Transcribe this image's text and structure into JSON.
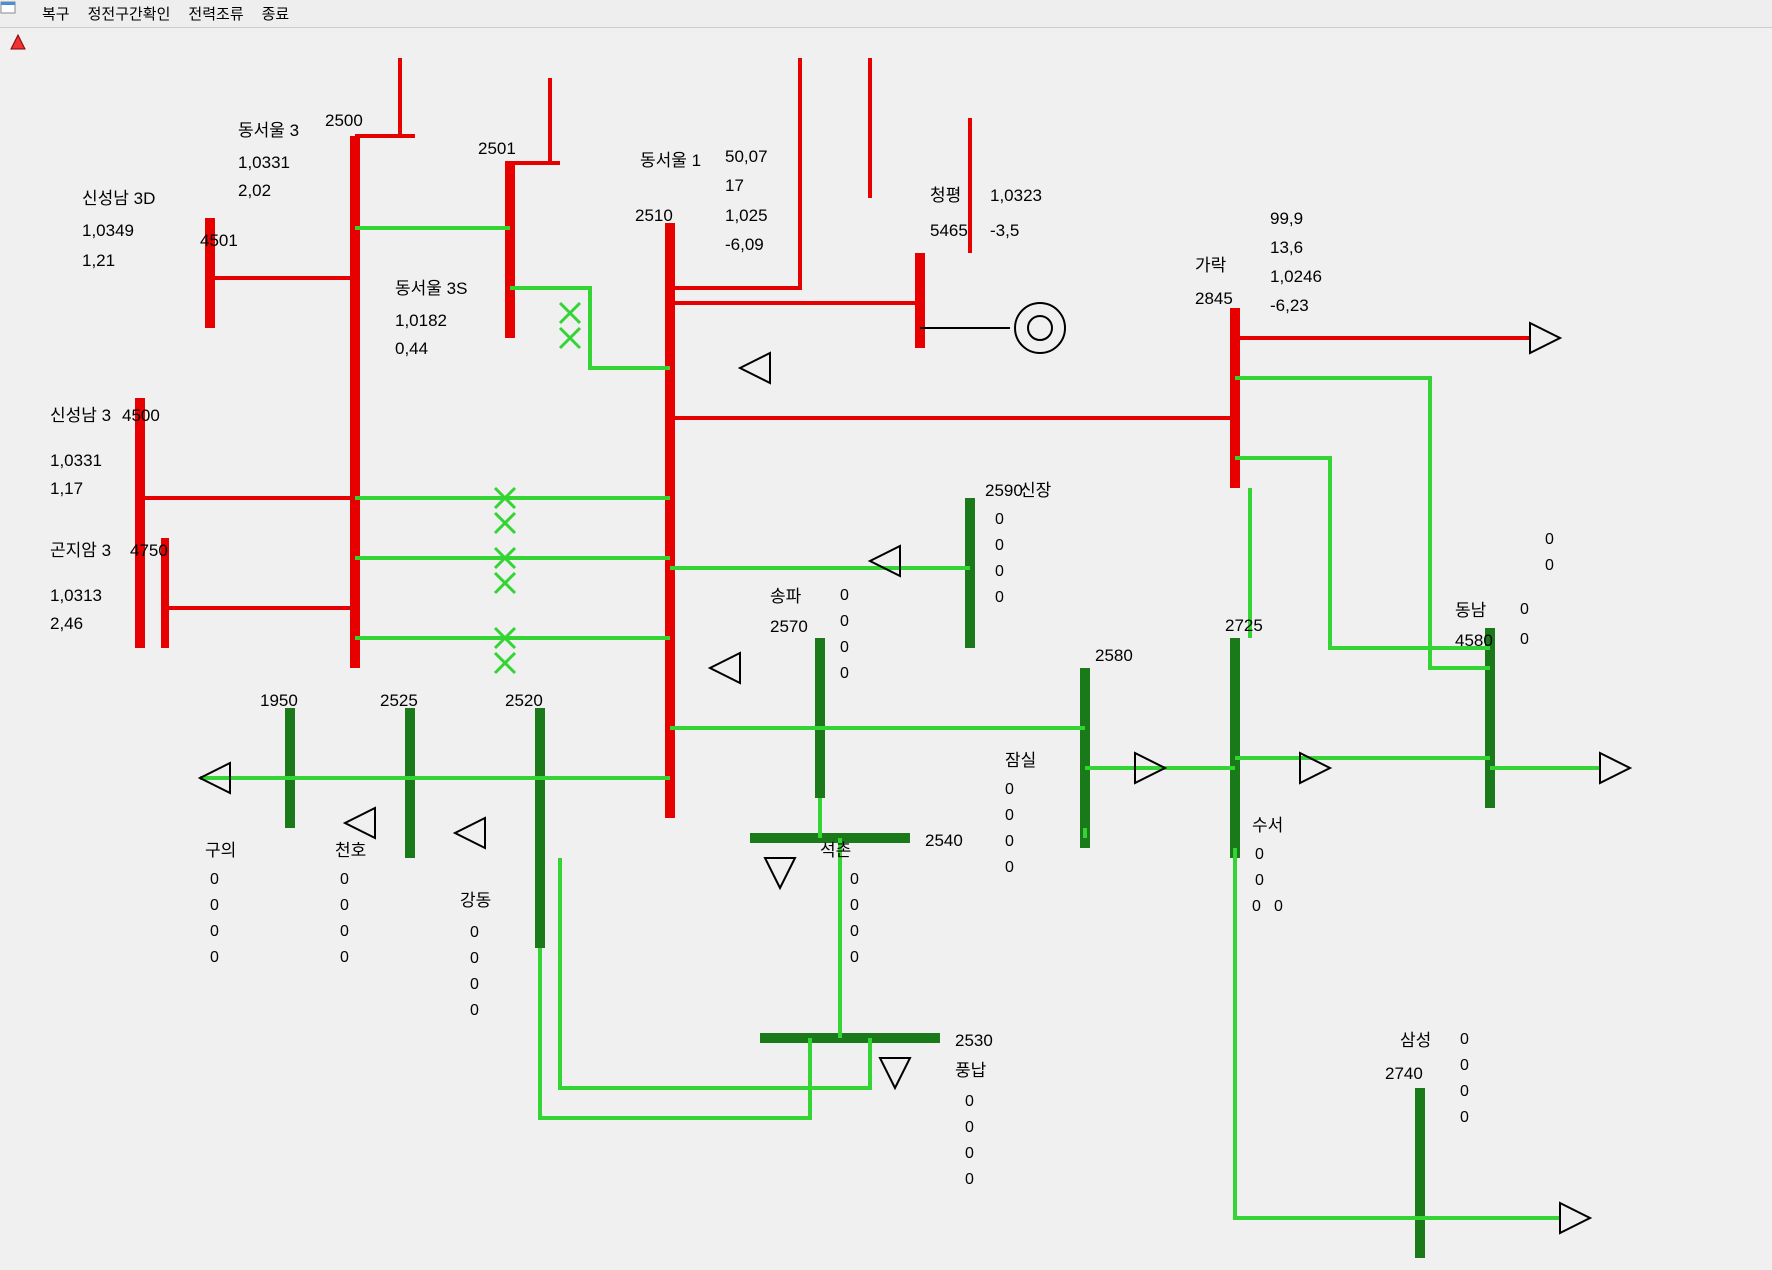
{
  "menu": {
    "restore": "복구",
    "check_outage": "정전구간확인",
    "power_flow": "전력조류",
    "exit": "종료"
  },
  "buses": {
    "sinseongnam3d": {
      "name": "신성남 3D",
      "id": "4501",
      "v": "1,0349",
      "p": "1,21"
    },
    "sinseongnam3": {
      "name": "신성남 3",
      "id": "4500",
      "v": "1,0331",
      "p": "1,17"
    },
    "gonjiam3": {
      "name": "곤지암 3",
      "id": "4750",
      "v": "1,0313",
      "p": "2,46"
    },
    "dongseoul3": {
      "name": "동서울 3",
      "id": "2500",
      "v": "1,0331",
      "p": "2,02"
    },
    "dongseoul3s": {
      "name": "동서울 3S",
      "id": "2501",
      "v": "1,0182",
      "p": "0,44"
    },
    "dongseoul1": {
      "name": "동서울 1",
      "id": "2510",
      "v1": "50,07",
      "v2": "17",
      "v3": "1,025",
      "v4": "-6,09"
    },
    "cheongpyeong": {
      "name": "청평",
      "id": "5465",
      "v": "1,0323",
      "p": "-3,5"
    },
    "garak": {
      "name": "가락",
      "id": "2845",
      "v1": "99,9",
      "v2": "13,6",
      "v3": "1,0246",
      "v4": "-6,23"
    },
    "sinjang": {
      "name": "신장",
      "id": "2590",
      "v1": "0",
      "v2": "0",
      "v3": "0",
      "v4": "0"
    },
    "songpa": {
      "name": "송파",
      "id": "2570",
      "v1": "0",
      "v2": "0",
      "v3": "0",
      "v4": "0"
    },
    "jamsil": {
      "name": "잠실",
      "id": "2580",
      "v1": "0",
      "v2": "0",
      "v3": "0",
      "v4": "0"
    },
    "suseo": {
      "name": "수서",
      "id": "2725",
      "v1": "0",
      "v2": "0",
      "v3": "0",
      "v4": "0"
    },
    "dongnam": {
      "name": "동남",
      "id": "4580",
      "v1": "0",
      "v2": "0",
      "v3": "0",
      "v4": "0"
    },
    "guui": {
      "name": "구의",
      "id": "1950",
      "v1": "0",
      "v2": "0",
      "v3": "0",
      "v4": "0"
    },
    "cheonho": {
      "name": "천호",
      "id": "2525",
      "v1": "0",
      "v2": "0",
      "v3": "0",
      "v4": "0"
    },
    "gangdong": {
      "name": "강동",
      "id": "2520",
      "v1": "0",
      "v2": "0",
      "v3": "0",
      "v4": "0"
    },
    "seokchon": {
      "name": "석촌",
      "id": "2540",
      "v1": "0",
      "v2": "0",
      "v3": "0",
      "v4": "0"
    },
    "pungnap": {
      "name": "풍납",
      "id": "2530",
      "v1": "0",
      "v2": "0",
      "v3": "0",
      "v4": "0"
    },
    "samseong": {
      "name": "삼성",
      "id": "2740",
      "v1": "0",
      "v2": "0",
      "v3": "0",
      "v4": "0"
    }
  }
}
